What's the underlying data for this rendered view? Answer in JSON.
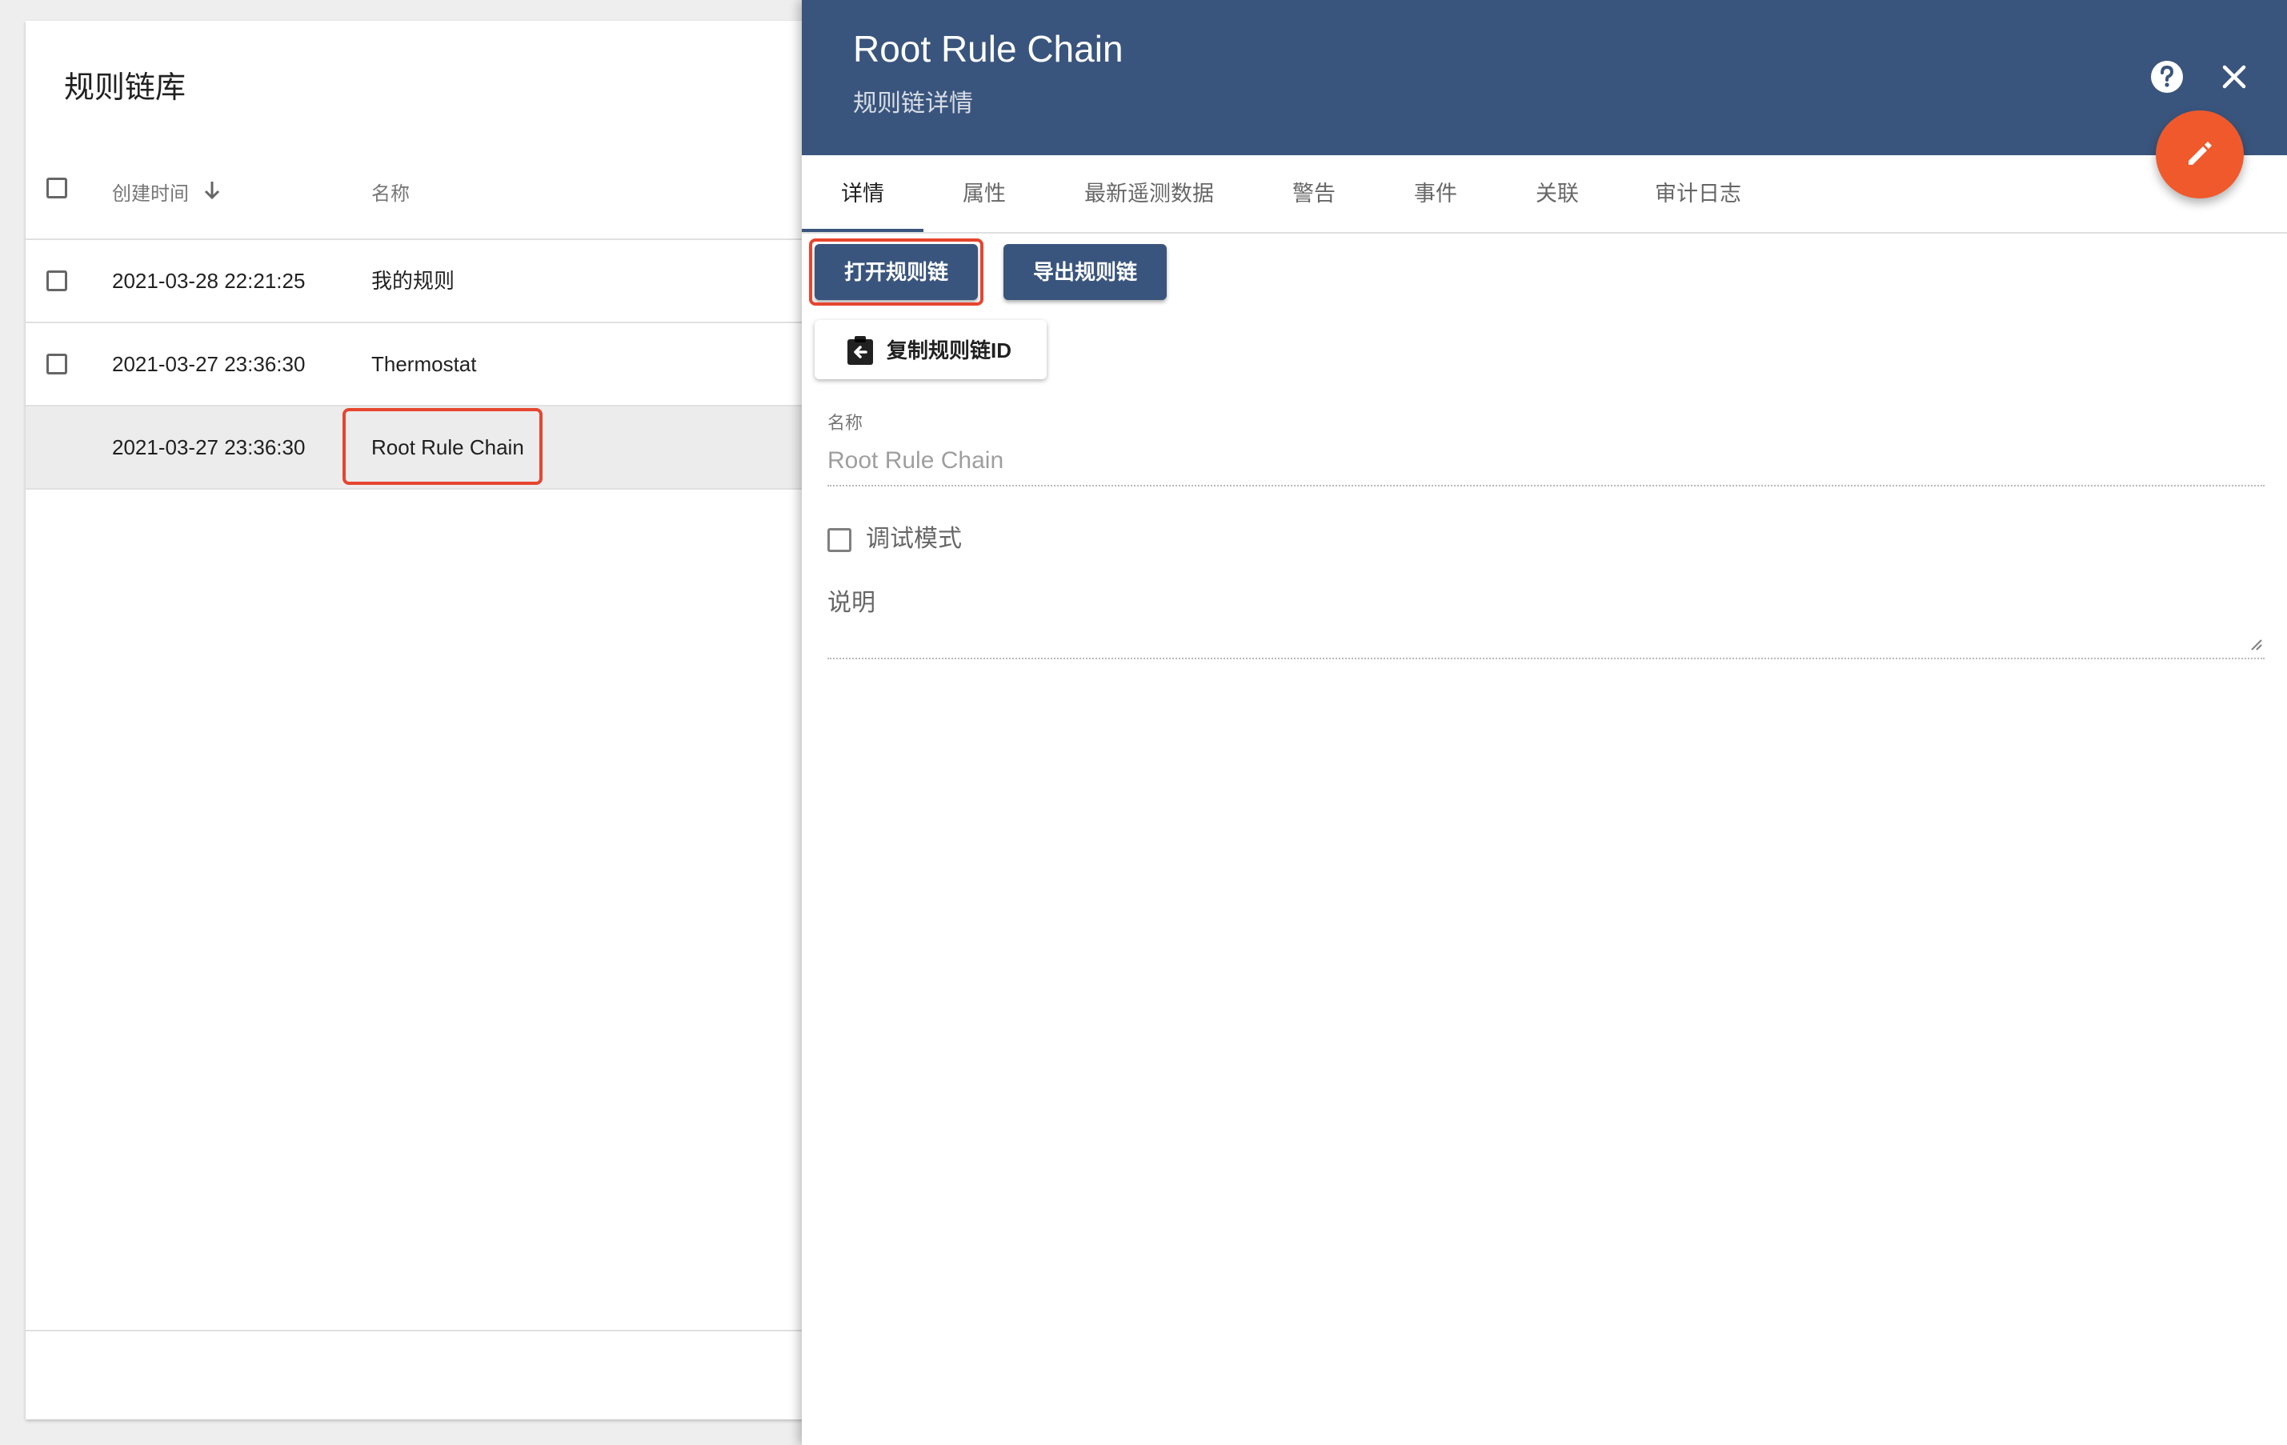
{
  "left_panel": {
    "title": "规则链库",
    "columns": {
      "created_time": "创建时间",
      "name": "名称"
    },
    "rows": [
      {
        "created": "2021-03-28 22:21:25",
        "name": "我的规则"
      },
      {
        "created": "2021-03-27 23:36:30",
        "name": "Thermostat"
      },
      {
        "created": "2021-03-27 23:36:30",
        "name": "Root Rule Chain"
      }
    ]
  },
  "drawer": {
    "title": "Root Rule Chain",
    "subtitle": "规则链详情",
    "tabs": [
      "详情",
      "属性",
      "最新遥测数据",
      "警告",
      "事件",
      "关联",
      "审计日志"
    ],
    "buttons": {
      "open": "打开规则链",
      "export": "导出规则链",
      "copy_id": "复制规则链ID"
    },
    "form": {
      "name_label": "名称",
      "name_value": "Root Rule Chain",
      "debug_label": "调试模式",
      "description_label": "说明"
    }
  },
  "colors": {
    "header_blue": "#3a557d",
    "fab_orange": "#f0592b",
    "highlight_red": "#e6452f"
  },
  "icons": [
    "checkbox",
    "sort-arrow-down-icon",
    "help-icon",
    "close-icon",
    "edit-pencil-icon",
    "clipboard-copy-icon",
    "resize-grip-icon"
  ]
}
